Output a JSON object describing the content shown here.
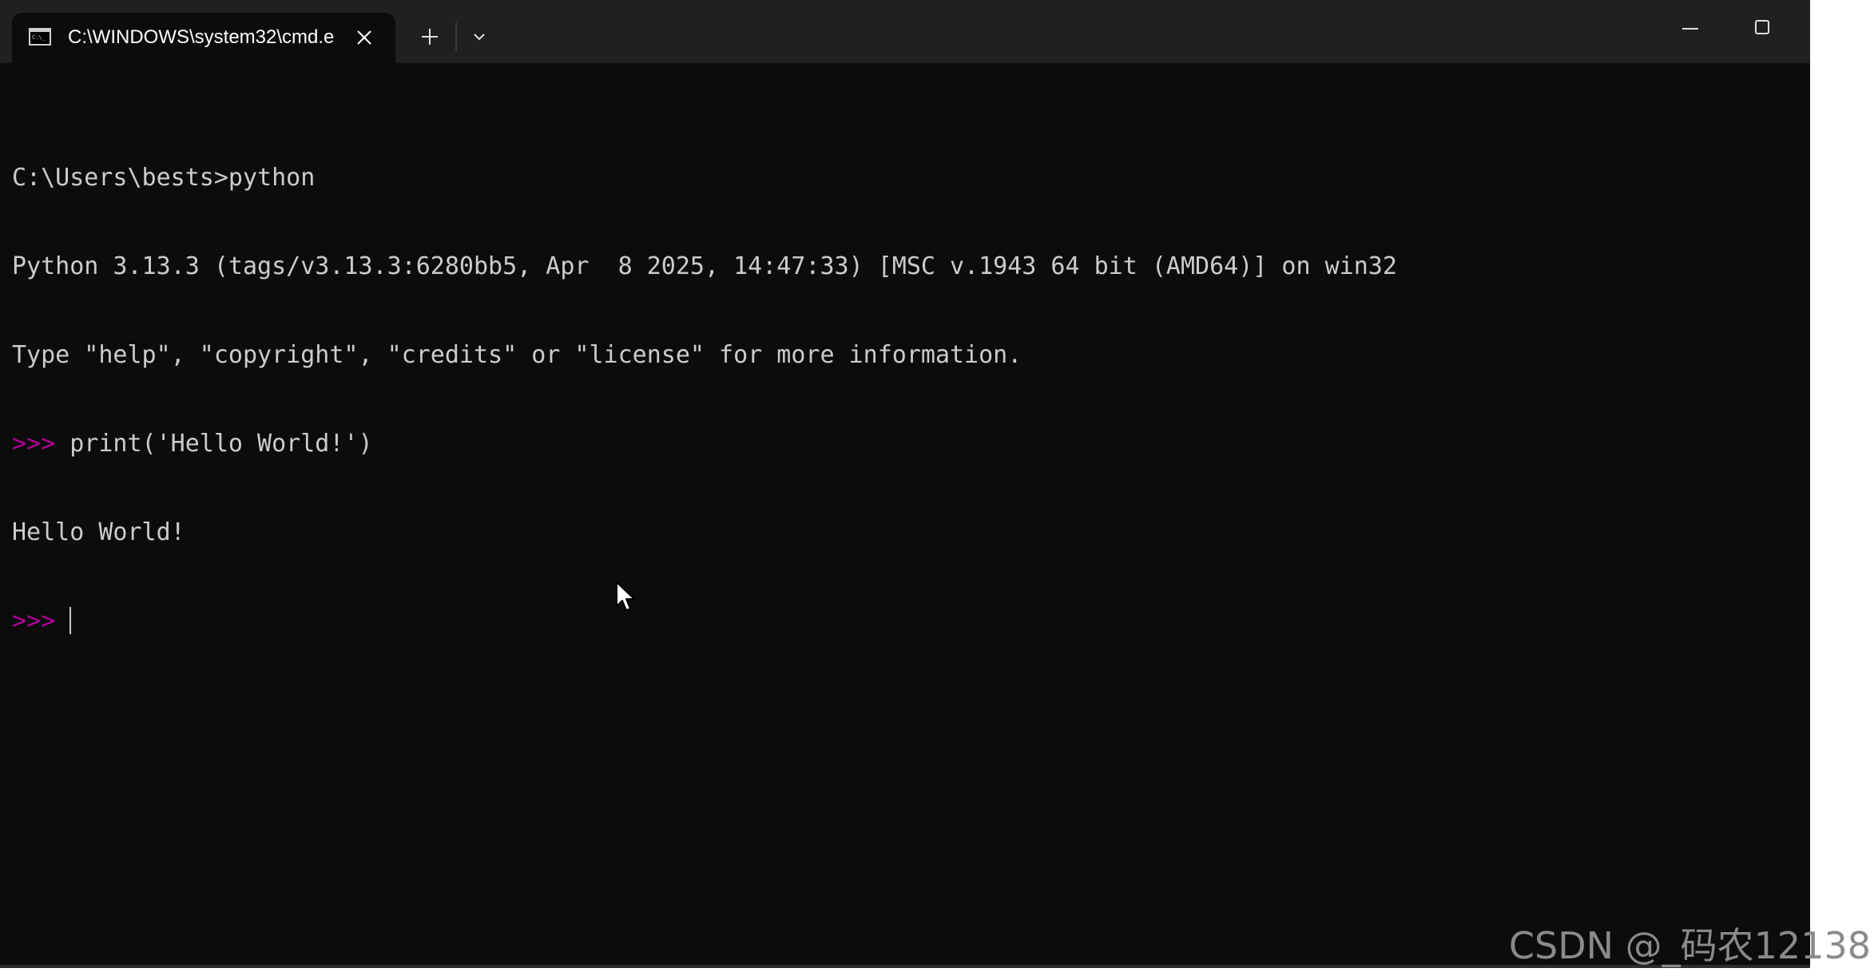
{
  "window": {
    "tab": {
      "title": "C:\\WINDOWS\\system32\\cmd.e",
      "icon": "cmd-terminal-icon"
    },
    "controls": {
      "new_tab_icon": "plus-icon",
      "dropdown_icon": "chevron-down-icon",
      "minimize_icon": "minimize-icon",
      "maximize_icon": "maximize-icon"
    }
  },
  "console": {
    "lines": [
      {
        "prompt": "",
        "text": "C:\\Users\\bests>python"
      },
      {
        "prompt": "",
        "text": "Python 3.13.3 (tags/v3.13.3:6280bb5, Apr  8 2025, 14:47:33) [MSC v.1943 64 bit (AMD64)] on win32"
      },
      {
        "prompt": "",
        "text": "Type \"help\", \"copyright\", \"credits\" or \"license\" for more information."
      },
      {
        "prompt": ">>> ",
        "text": "print('Hello World!')"
      },
      {
        "prompt": "",
        "text": "Hello World!"
      },
      {
        "prompt": ">>> ",
        "text": ""
      }
    ]
  },
  "colors": {
    "terminal_background": "#0c0c0c",
    "titlebar_background": "#202020",
    "text": "#cccccc",
    "prompt": "#b4009e"
  },
  "watermark": "CSDN @_码农12138"
}
